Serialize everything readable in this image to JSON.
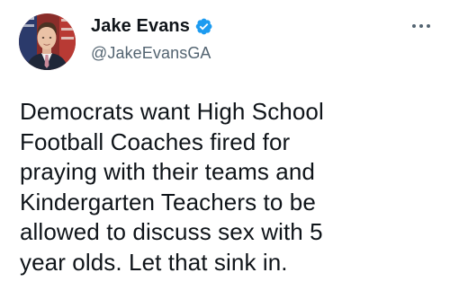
{
  "author": {
    "display_name": "Jake Evans",
    "handle": "@JakeEvansGA",
    "verified": true,
    "verified_badge_color": "#1d9bf0"
  },
  "tweet": {
    "text": "Democrats want High School\nFootball Coaches fired for\npraying with their teams and\nKindergarten Teachers to be\nallowed to discuss sex with 5\nyear olds. Let that sink in."
  },
  "icons": {
    "more": "more-options-icon",
    "verified": "verified-badge-icon",
    "avatar": "profile-photo"
  },
  "colors": {
    "text_primary": "#0f1419",
    "text_secondary": "#536471",
    "accent": "#1d9bf0"
  }
}
